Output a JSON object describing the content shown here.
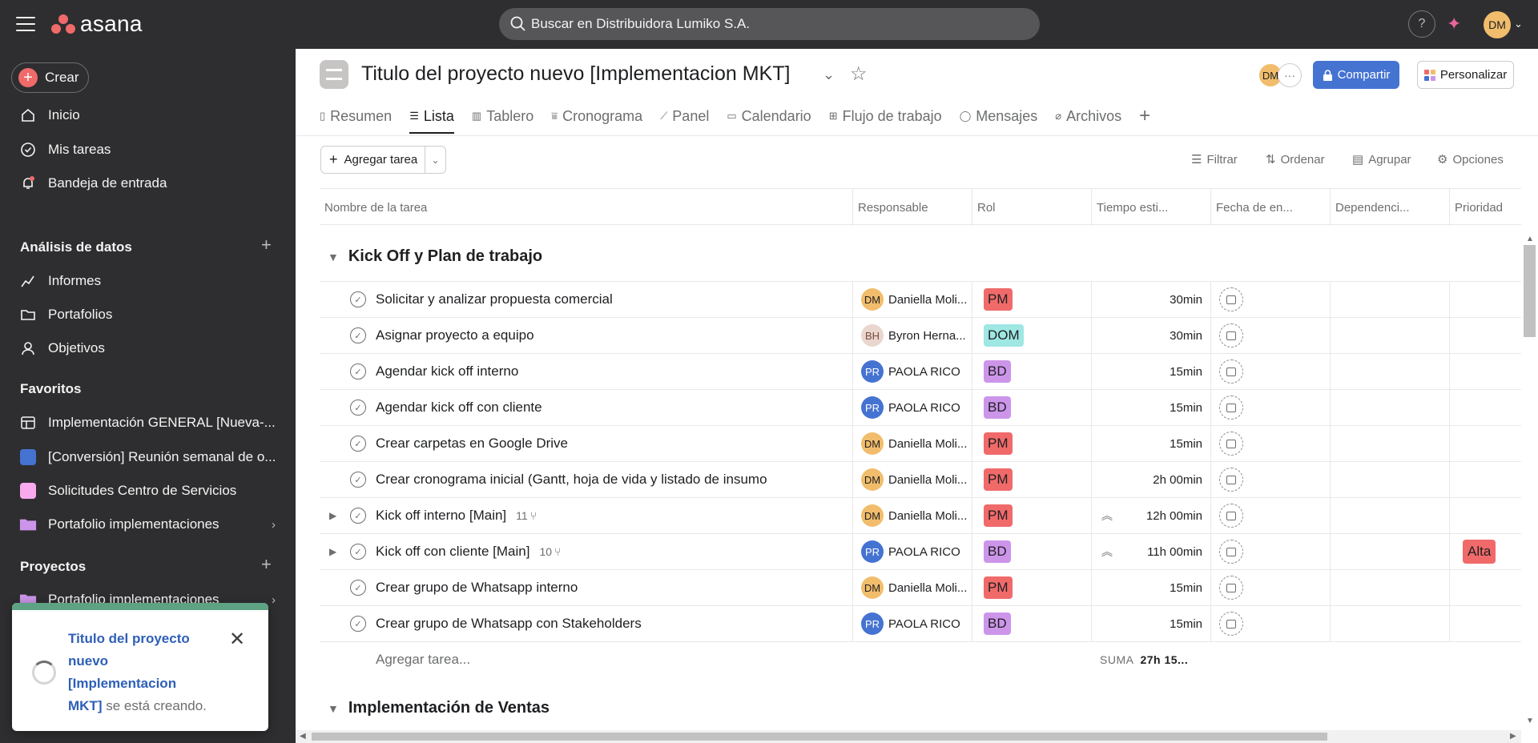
{
  "topbar": {
    "logo": "asana",
    "search_placeholder": "Buscar en Distribuidora Lumiko S.A.",
    "help": "?",
    "user_initials": "DM"
  },
  "sidebar": {
    "create_label": "Crear",
    "nav": [
      "Inicio",
      "Mis tareas",
      "Bandeja de entrada"
    ],
    "analysis_title": "Análisis de datos",
    "analysis_items": [
      "Informes",
      "Portafolios",
      "Objetivos"
    ],
    "favorites_title": "Favoritos",
    "favorites": [
      {
        "label": "Implementación GENERAL [Nueva-...",
        "icon": "board-icon",
        "color": ""
      },
      {
        "label": "[Conversión] Reunión semanal de o...",
        "icon": "square",
        "color": "#4573d2"
      },
      {
        "label": "Solicitudes Centro de Servicios",
        "icon": "square",
        "color": "#f9aaef"
      },
      {
        "label": "Portafolio implementaciones",
        "icon": "folder",
        "color": "#cd95ea"
      }
    ],
    "projects_title": "Proyectos",
    "projects": [
      {
        "label": "Portafolio implementaciones",
        "color": "#cd95ea"
      }
    ]
  },
  "toast": {
    "bold": "Titulo del proyecto nuevo [Implementacion MKT]",
    "rest": " se está creando."
  },
  "project": {
    "title": "Titulo del proyecto nuevo [Implementacion MKT]",
    "member_initials": "DM",
    "more": "···",
    "share_label": "Compartir",
    "customize_label": "Personalizar"
  },
  "tabs": [
    "Resumen",
    "Lista",
    "Tablero",
    "Cronograma",
    "Panel",
    "Calendario",
    "Flujo de trabajo",
    "Mensajes",
    "Archivos"
  ],
  "active_tab": "Lista",
  "toolbar": {
    "add_task": "Agregar tarea",
    "filter": "Filtrar",
    "sort": "Ordenar",
    "group": "Agrupar",
    "options": "Opciones"
  },
  "columns": [
    "Nombre de la tarea",
    "Responsable",
    "Rol",
    "Tiempo esti...",
    "Fecha de en...",
    "Dependenci...",
    "Prioridad"
  ],
  "sections": [
    {
      "title": "Kick Off y Plan de trabajo"
    },
    {
      "title": "Implementación de Ventas"
    }
  ],
  "roles": {
    "PM": "#f06a6a",
    "DOM": "#9ee7e3",
    "BD": "#cd95ea"
  },
  "tasks": [
    {
      "name": "Solicitar y analizar propuesta comercial",
      "initials": "DM",
      "assignee": "Daniella Moli...",
      "role": "PM",
      "time": "30min",
      "subtasks": "",
      "priority": ""
    },
    {
      "name": "Asignar proyecto a equipo",
      "initials": "BH",
      "assignee": "Byron Herna...",
      "role": "DOM",
      "time": "30min",
      "subtasks": "",
      "priority": ""
    },
    {
      "name": "Agendar kick off interno",
      "initials": "PR",
      "assignee": "PAOLA RICO",
      "role": "BD",
      "time": "15min",
      "subtasks": "",
      "priority": ""
    },
    {
      "name": "Agendar kick off con cliente",
      "initials": "PR",
      "assignee": "PAOLA RICO",
      "role": "BD",
      "time": "15min",
      "subtasks": "",
      "priority": ""
    },
    {
      "name": "Crear carpetas en Google Drive",
      "initials": "DM",
      "assignee": "Daniella Moli...",
      "role": "PM",
      "time": "15min",
      "subtasks": "",
      "priority": ""
    },
    {
      "name": "Crear cronograma inicial (Gantt, hoja de vida y listado de insumo",
      "initials": "DM",
      "assignee": "Daniella Moli...",
      "role": "PM",
      "time": "2h 00min",
      "subtasks": "",
      "priority": ""
    },
    {
      "name": "Kick off interno [Main]",
      "initials": "DM",
      "assignee": "Daniella Moli...",
      "role": "PM",
      "time": "12h 00min",
      "subtasks": "11",
      "priority": ""
    },
    {
      "name": "Kick off con cliente [Main]",
      "initials": "PR",
      "assignee": "PAOLA RICO",
      "role": "BD",
      "time": "11h 00min",
      "subtasks": "10",
      "priority": "Alta"
    },
    {
      "name": "Crear grupo de Whatsapp interno",
      "initials": "DM",
      "assignee": "Daniella Moli...",
      "role": "PM",
      "time": "15min",
      "subtasks": "",
      "priority": ""
    },
    {
      "name": "Crear grupo de Whatsapp con Stakeholders",
      "initials": "PR",
      "assignee": "PAOLA RICO",
      "role": "BD",
      "time": "15min",
      "subtasks": "",
      "priority": ""
    }
  ],
  "footer": {
    "add_task_inline": "Agregar tarea...",
    "sum_label": "SUMA",
    "sum_value": "27h 15..."
  }
}
